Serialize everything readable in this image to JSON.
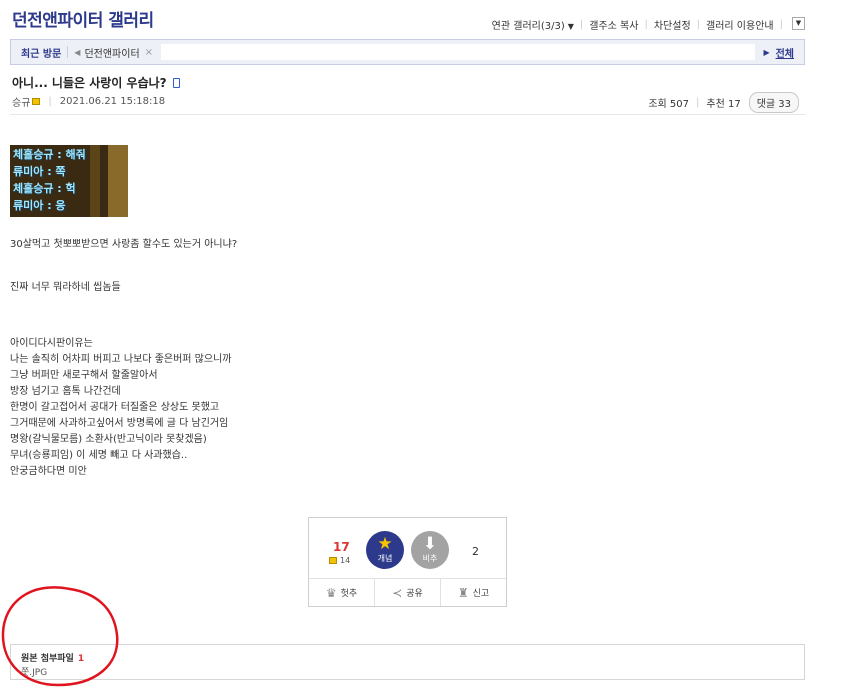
{
  "header": {
    "gallery_title": "던전앤파이터 갤러리",
    "links": [
      "연관 갤러리(3/3)",
      "갤주소 복사",
      "차단설정",
      "갤러리 이용안내"
    ]
  },
  "recent_visit": {
    "label": "최근 방문",
    "item": "던전앤파이터",
    "close": "×",
    "all": "전체"
  },
  "post": {
    "title": "아니... 니들은 사랑이 우습나?",
    "author": "승규",
    "datetime": "2021.06.21 15:18:18",
    "views_label": "조회 507",
    "recommend_label": "추천 17",
    "comments_label": "댓글 33"
  },
  "image_text": [
    "체홀승규 : 해줘",
    "류미아 : 쪽",
    "체홀승규 : 헉",
    "류미아 : 응"
  ],
  "body_lines": [
    "30살먹고 첫뽀뽀받으면 사랑좀 할수도 있는거 아니냐?",
    "진짜 너무 뭐라하네 씹놈들",
    "아이디다시판이유는",
    "나는 솔직히 어차피 버피고 나보다 좋은버퍼 많으니까",
    "그냥 버퍼만 새로구해서 할줄알아서",
    "방장 넘기고 홈톡 나간건데",
    "한명이 갈고접어서 공대가 터질줄은 상상도 못했고",
    "그거때문에 사과하고싶어서 방명록에 글 다 남긴거임",
    "명왕(갈닉물모름) 소환사(반고닉이라 못찾겠음)",
    "무녀(승룡피임) 이 세명 빼고 다 사과했습..",
    "안궁금하다면 미안"
  ],
  "recommend": {
    "up_count": "17",
    "fix_count": "14",
    "up_label": "개념",
    "down_label": "비추",
    "down_count": "2",
    "actions": [
      "헛추",
      "공유",
      "신고"
    ]
  },
  "attachment": {
    "title": "원본 첨부파일",
    "count": "1",
    "file": "쫏.JPG"
  },
  "icons": [
    "chevron-down-icon",
    "phone-icon",
    "fix-star-icon",
    "star-icon",
    "thumb-down-icon",
    "crown-icon",
    "share-icon",
    "siren-icon"
  ],
  "colors": {
    "brand": "#2d3a8c",
    "count_red": "#dd3333",
    "annotation_circle": "#e0141e"
  }
}
